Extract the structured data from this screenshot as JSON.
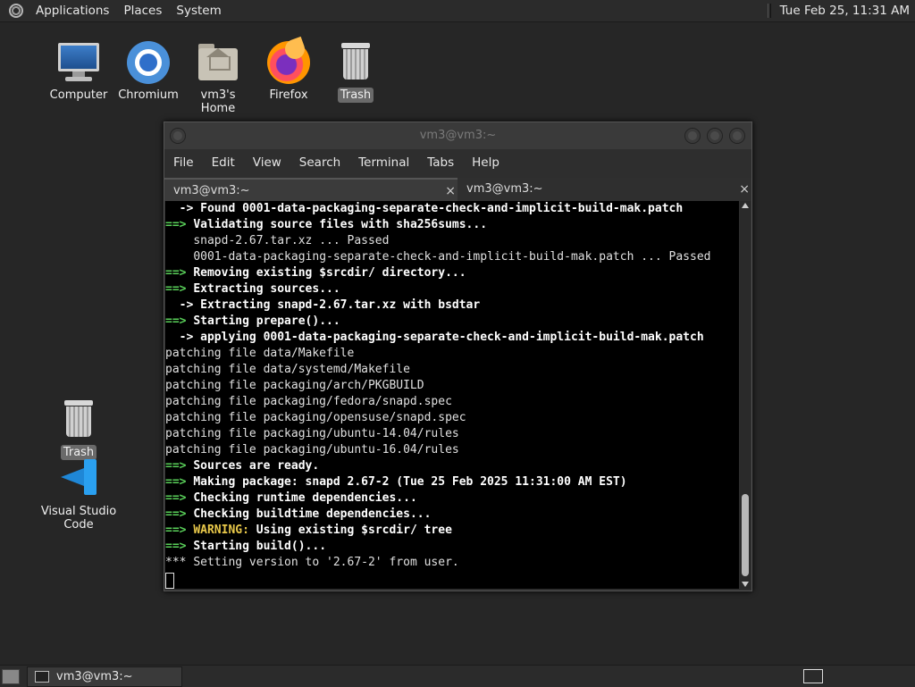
{
  "top_panel": {
    "menus": [
      "Applications",
      "Places",
      "System"
    ],
    "clock": "Tue Feb 25, 11:31 AM"
  },
  "desktop_icons": {
    "computer": "Computer",
    "chromium": "Chromium",
    "home": "vm3's Home",
    "firefox": "Firefox",
    "trash_top": "Trash",
    "trash_left": "Trash",
    "vscode": "Visual Studio Code"
  },
  "window": {
    "title": "vm3@vm3:~",
    "menu": [
      "File",
      "Edit",
      "View",
      "Search",
      "Terminal",
      "Tabs",
      "Help"
    ],
    "tabs": [
      "vm3@vm3:~",
      "vm3@vm3:~"
    ],
    "close_glyph": "×"
  },
  "terminal": {
    "lines": [
      {
        "prefix": "  -> ",
        "pstyle": "b",
        "text": "Found 0001-data-packaging-separate-check-and-implicit-build-mak.patch",
        "tstyle": "b"
      },
      {
        "prefix": "==> ",
        "pstyle": "g",
        "text": "Validating source files with sha256sums...",
        "tstyle": "b"
      },
      {
        "prefix": "    ",
        "pstyle": "",
        "text": "snapd-2.67.tar.xz ... Passed",
        "tstyle": ""
      },
      {
        "prefix": "    ",
        "pstyle": "",
        "text": "0001-data-packaging-separate-check-and-implicit-build-mak.patch ... Passed",
        "tstyle": ""
      },
      {
        "prefix": "==> ",
        "pstyle": "g",
        "text": "Removing existing $srcdir/ directory...",
        "tstyle": "b"
      },
      {
        "prefix": "==> ",
        "pstyle": "g",
        "text": "Extracting sources...",
        "tstyle": "b"
      },
      {
        "prefix": "  -> ",
        "pstyle": "b",
        "text": "Extracting snapd-2.67.tar.xz with bsdtar",
        "tstyle": "b"
      },
      {
        "prefix": "==> ",
        "pstyle": "g",
        "text": "Starting prepare()...",
        "tstyle": "b"
      },
      {
        "prefix": "  -> ",
        "pstyle": "b",
        "text": "applying 0001-data-packaging-separate-check-and-implicit-build-mak.patch",
        "tstyle": "b"
      },
      {
        "prefix": "",
        "pstyle": "",
        "text": "patching file data/Makefile",
        "tstyle": ""
      },
      {
        "prefix": "",
        "pstyle": "",
        "text": "patching file data/systemd/Makefile",
        "tstyle": ""
      },
      {
        "prefix": "",
        "pstyle": "",
        "text": "patching file packaging/arch/PKGBUILD",
        "tstyle": ""
      },
      {
        "prefix": "",
        "pstyle": "",
        "text": "patching file packaging/fedora/snapd.spec",
        "tstyle": ""
      },
      {
        "prefix": "",
        "pstyle": "",
        "text": "patching file packaging/opensuse/snapd.spec",
        "tstyle": ""
      },
      {
        "prefix": "",
        "pstyle": "",
        "text": "patching file packaging/ubuntu-14.04/rules",
        "tstyle": ""
      },
      {
        "prefix": "",
        "pstyle": "",
        "text": "patching file packaging/ubuntu-16.04/rules",
        "tstyle": ""
      },
      {
        "prefix": "==> ",
        "pstyle": "g",
        "text": "Sources are ready.",
        "tstyle": "b"
      },
      {
        "prefix": "==> ",
        "pstyle": "g",
        "text": "Making package: snapd 2.67-2 (Tue 25 Feb 2025 11:31:00 AM EST)",
        "tstyle": "b"
      },
      {
        "prefix": "==> ",
        "pstyle": "g",
        "text": "Checking runtime dependencies...",
        "tstyle": "b"
      },
      {
        "prefix": "==> ",
        "pstyle": "g",
        "text": "Checking buildtime dependencies...",
        "tstyle": "b"
      },
      {
        "prefix": "==> ",
        "pstyle": "g",
        "text": "WARNING:",
        "tstyle": "y",
        "suffix": " Using existing $srcdir/ tree"
      },
      {
        "prefix": "==> ",
        "pstyle": "g",
        "text": "Starting build()...",
        "tstyle": "b"
      },
      {
        "prefix": "*** ",
        "pstyle": "",
        "text": "Setting version to '2.67-2' from user.",
        "tstyle": ""
      }
    ]
  },
  "bottom_panel": {
    "task": "vm3@vm3:~"
  }
}
